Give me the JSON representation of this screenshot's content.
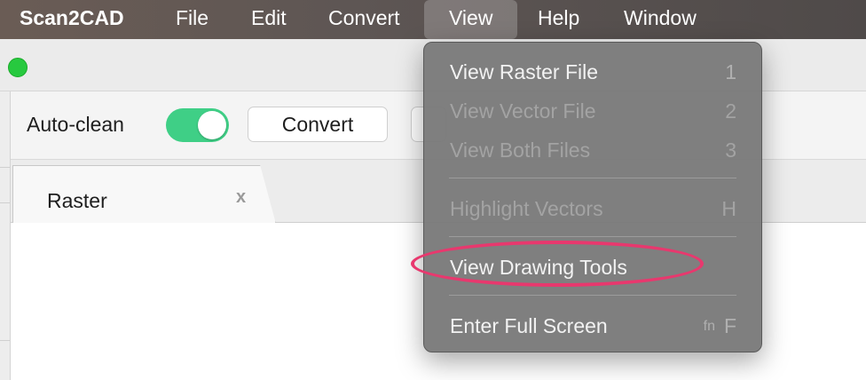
{
  "menubar": {
    "app": "Scan2CAD",
    "file": "File",
    "edit": "Edit",
    "convert": "Convert",
    "view": "View",
    "help": "Help",
    "window": "Window"
  },
  "toolbar": {
    "autoclean_label": "Auto-clean",
    "autoclean_on": true,
    "convert_button": "Convert"
  },
  "tabs": [
    {
      "label": "Raster",
      "close": "x"
    }
  ],
  "view_menu": {
    "items": [
      {
        "label": "View Raster File",
        "shortcut": "1",
        "enabled": true
      },
      {
        "label": "View Vector File",
        "shortcut": "2",
        "enabled": false
      },
      {
        "label": "View Both Files",
        "shortcut": "3",
        "enabled": false
      },
      {
        "label": "Highlight Vectors",
        "shortcut": "H",
        "enabled": false
      },
      {
        "label": "View Drawing Tools",
        "shortcut": "",
        "enabled": true,
        "annotated": true
      },
      {
        "label": "Enter Full Screen",
        "shortcut_fn": "fn",
        "shortcut": "F",
        "enabled": true
      }
    ]
  },
  "colors": {
    "toggle_on": "#3fcf86",
    "traffic_green": "#27c93f",
    "annotation_ring": "#e8386e"
  }
}
